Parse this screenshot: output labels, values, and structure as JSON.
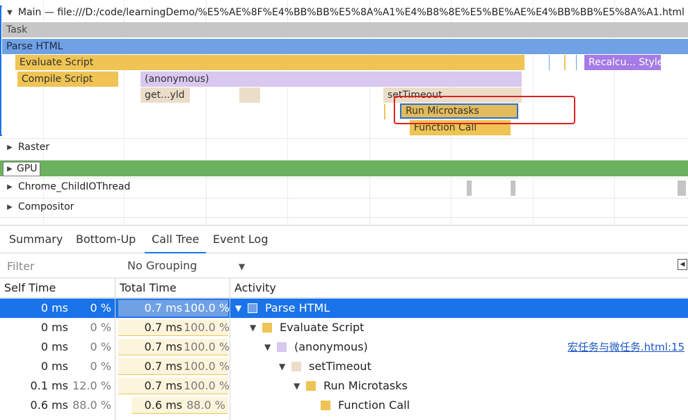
{
  "flame": {
    "main_title": "Main — file:///D:/code/learningDemo/%E5%AE%8F%E4%BB%BB%E5%8A%A1%E4%B8%8E%E5%BE%AE%E4%BB%BB%E5%8A%A1.html",
    "bars": {
      "task": "Task",
      "parse_html": "Parse HTML",
      "evaluate_script": "Evaluate Script",
      "recalc_style": "Recalcu... Style",
      "compile_script": "Compile Script",
      "anonymous": "(anonymous)",
      "get_yld": "get...yld",
      "set_timeout": "setTimeout",
      "run_microtasks": "Run Microtasks",
      "function_call": "Function Call"
    },
    "tracks": {
      "raster": "Raster",
      "gpu": "GPU",
      "child_io": "Chrome_ChildIOThread",
      "compositor": "Compositor"
    }
  },
  "tabs": [
    "Summary",
    "Bottom-Up",
    "Call Tree",
    "Event Log"
  ],
  "active_tab": "Call Tree",
  "filter": {
    "placeholder": "Filter",
    "grouping": "No Grouping"
  },
  "table": {
    "headers": {
      "self_time": "Self Time",
      "total_time": "Total Time",
      "activity": "Activity"
    },
    "rows": [
      {
        "self_ms": "0 ms",
        "self_pct": "0 %",
        "total_ms": "0.7 ms",
        "total_pct": "100.0 %",
        "activity": "Parse HTML",
        "depth": 0,
        "color": "#6fa1e4",
        "source": ""
      },
      {
        "self_ms": "0 ms",
        "self_pct": "0 %",
        "total_ms": "0.7 ms",
        "total_pct": "100.0 %",
        "activity": "Evaluate Script",
        "depth": 1,
        "color": "#efc454",
        "source": ""
      },
      {
        "self_ms": "0 ms",
        "self_pct": "0 %",
        "total_ms": "0.7 ms",
        "total_pct": "100.0 %",
        "activity": "(anonymous)",
        "depth": 2,
        "color": "#d9c8ef",
        "source": "宏任务与微任务.html:15"
      },
      {
        "self_ms": "0 ms",
        "self_pct": "0 %",
        "total_ms": "0.7 ms",
        "total_pct": "100.0 %",
        "activity": "setTimeout",
        "depth": 3,
        "color": "#ecddc9",
        "source": ""
      },
      {
        "self_ms": "0.1 ms",
        "self_pct": "12.0 %",
        "total_ms": "0.7 ms",
        "total_pct": "100.0 %",
        "activity": "Run Microtasks",
        "depth": 4,
        "color": "#efc454",
        "source": ""
      },
      {
        "self_ms": "0.6 ms",
        "self_pct": "88.0 %",
        "total_ms": "0.6 ms",
        "total_pct": "88.0 %",
        "activity": "Function Call",
        "depth": 5,
        "color": "#efc454",
        "source": ""
      }
    ]
  }
}
